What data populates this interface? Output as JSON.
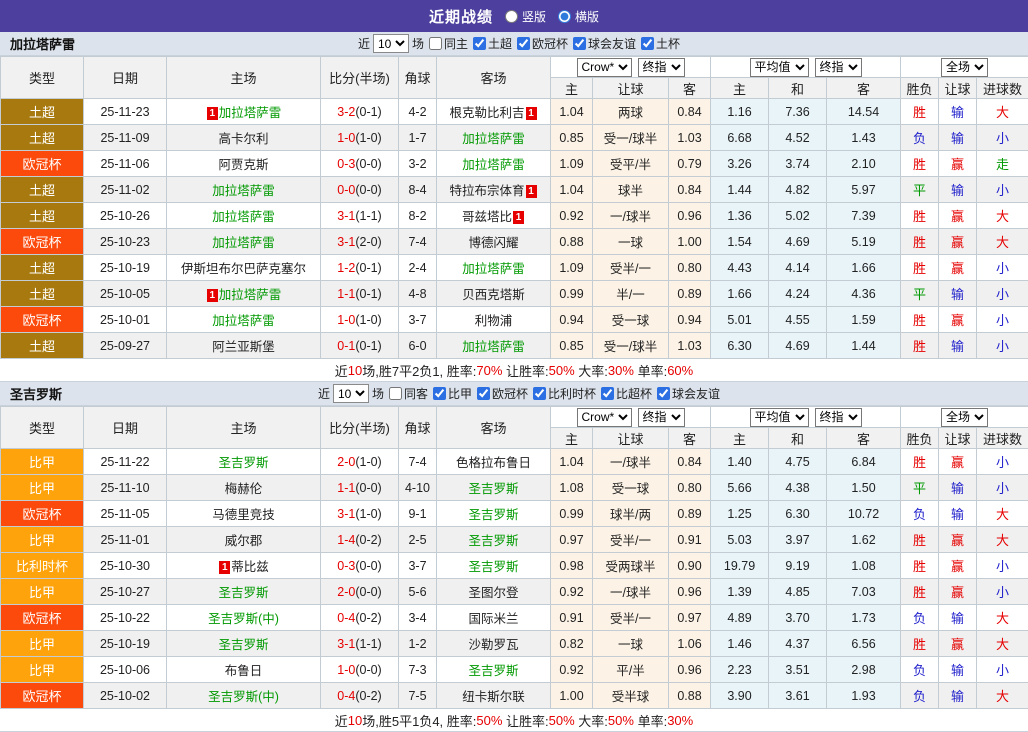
{
  "titlebar": {
    "title": "近期战绩",
    "options": [
      {
        "label": "竖版"
      },
      {
        "label": "横版",
        "checked": "checked"
      }
    ]
  },
  "colors": {
    "topbar_bg": "#4c3f9d",
    "team_highlight": "#009900",
    "score_red": "#e60000",
    "badge_bg": "#e60000"
  },
  "type_colors": {
    "土超": "#a8790f",
    "欧冠杯": "#fb4a0c",
    "比甲": "#ffa30d",
    "比利时杯": "#ffa30d"
  },
  "result_colors": {
    "胜": "#e60000",
    "赢": "#e60000",
    "大": "#e60000",
    "负": "#2222cc",
    "输": "#2222cc",
    "小": "#2222cc",
    "平": "#009900",
    "走": "#009900"
  },
  "table_header": {
    "main_cols": [
      "类型",
      "日期",
      "主场",
      "比分(半场)",
      "角球",
      "客场"
    ],
    "odds_selects": [
      "Crow*",
      "终指"
    ],
    "avg_selects": [
      "平均值",
      "终指"
    ],
    "result_selects": [
      "全场"
    ],
    "sub_cols": [
      "主",
      "让球",
      "客",
      "主",
      "和",
      "客",
      "胜负",
      "让球",
      "进球数"
    ]
  },
  "sections": [
    {
      "team": "加拉塔萨雷",
      "filter": {
        "near_label": "近",
        "count": "10",
        "games_label": "场",
        "same_label": "同主",
        "same_checked": false,
        "leagues": [
          "土超",
          "欧冠杯",
          "球会友谊",
          "土杯"
        ]
      },
      "rows": [
        {
          "type": "土超",
          "date": "25-11-23",
          "home": {
            "name": "加拉塔萨雷",
            "green": true,
            "badge": "before"
          },
          "score": "3-2",
          "half": "(0-1)",
          "corner": "4-2",
          "away": {
            "name": "根克勒比利吉",
            "badge": "after"
          },
          "odds": [
            "1.04",
            "两球",
            "0.84"
          ],
          "avg": [
            "1.16",
            "7.36",
            "14.54"
          ],
          "res": [
            "胜",
            "输",
            "大"
          ]
        },
        {
          "type": "土超",
          "date": "25-11-09",
          "home": {
            "name": "高卡尔利"
          },
          "score": "1-0",
          "half": "(1-0)",
          "corner": "1-7",
          "away": {
            "name": "加拉塔萨雷",
            "green": true
          },
          "odds": [
            "0.85",
            "受一/球半",
            "1.03"
          ],
          "avg": [
            "6.68",
            "4.52",
            "1.43"
          ],
          "res": [
            "负",
            "输",
            "小"
          ]
        },
        {
          "type": "欧冠杯",
          "date": "25-11-06",
          "home": {
            "name": "阿贾克斯"
          },
          "score": "0-3",
          "half": "(0-0)",
          "corner": "3-2",
          "away": {
            "name": "加拉塔萨雷",
            "green": true
          },
          "odds": [
            "1.09",
            "受平/半",
            "0.79"
          ],
          "avg": [
            "3.26",
            "3.74",
            "2.10"
          ],
          "res": [
            "胜",
            "赢",
            "走"
          ]
        },
        {
          "type": "土超",
          "date": "25-11-02",
          "home": {
            "name": "加拉塔萨雷",
            "green": true
          },
          "score": "0-0",
          "half": "(0-0)",
          "corner": "8-4",
          "away": {
            "name": "特拉布宗体育",
            "badge": "after"
          },
          "odds": [
            "1.04",
            "球半",
            "0.84"
          ],
          "avg": [
            "1.44",
            "4.82",
            "5.97"
          ],
          "res": [
            "平",
            "输",
            "小"
          ]
        },
        {
          "type": "土超",
          "date": "25-10-26",
          "home": {
            "name": "加拉塔萨雷",
            "green": true
          },
          "score": "3-1",
          "half": "(1-1)",
          "corner": "8-2",
          "away": {
            "name": "哥兹塔比",
            "badge": "after"
          },
          "odds": [
            "0.92",
            "一/球半",
            "0.96"
          ],
          "avg": [
            "1.36",
            "5.02",
            "7.39"
          ],
          "res": [
            "胜",
            "赢",
            "大"
          ]
        },
        {
          "type": "欧冠杯",
          "date": "25-10-23",
          "home": {
            "name": "加拉塔萨雷",
            "green": true
          },
          "score": "3-1",
          "half": "(2-0)",
          "corner": "7-4",
          "away": {
            "name": "博德闪耀"
          },
          "odds": [
            "0.88",
            "一球",
            "1.00"
          ],
          "avg": [
            "1.54",
            "4.69",
            "5.19"
          ],
          "res": [
            "胜",
            "赢",
            "大"
          ]
        },
        {
          "type": "土超",
          "date": "25-10-19",
          "home": {
            "name": "伊斯坦布尔巴萨克塞尔"
          },
          "score": "1-2",
          "half": "(0-1)",
          "corner": "2-4",
          "away": {
            "name": "加拉塔萨雷",
            "green": true
          },
          "odds": [
            "1.09",
            "受半/一",
            "0.80"
          ],
          "avg": [
            "4.43",
            "4.14",
            "1.66"
          ],
          "res": [
            "胜",
            "赢",
            "小"
          ]
        },
        {
          "type": "土超",
          "date": "25-10-05",
          "home": {
            "name": "加拉塔萨雷",
            "green": true,
            "badge": "before"
          },
          "score": "1-1",
          "half": "(0-1)",
          "corner": "4-8",
          "away": {
            "name": "贝西克塔斯"
          },
          "odds": [
            "0.99",
            "半/一",
            "0.89"
          ],
          "avg": [
            "1.66",
            "4.24",
            "4.36"
          ],
          "res": [
            "平",
            "输",
            "小"
          ]
        },
        {
          "type": "欧冠杯",
          "date": "25-10-01",
          "home": {
            "name": "加拉塔萨雷",
            "green": true
          },
          "score": "1-0",
          "half": "(1-0)",
          "corner": "3-7",
          "away": {
            "name": "利物浦"
          },
          "odds": [
            "0.94",
            "受一球",
            "0.94"
          ],
          "avg": [
            "5.01",
            "4.55",
            "1.59"
          ],
          "res": [
            "胜",
            "赢",
            "小"
          ]
        },
        {
          "type": "土超",
          "date": "25-09-27",
          "home": {
            "name": "阿兰亚斯堡"
          },
          "score": "0-1",
          "half": "(0-1)",
          "corner": "6-0",
          "away": {
            "name": "加拉塔萨雷",
            "green": true
          },
          "odds": [
            "0.85",
            "受一/球半",
            "1.03"
          ],
          "avg": [
            "6.30",
            "4.69",
            "1.44"
          ],
          "res": [
            "胜",
            "输",
            "小"
          ]
        }
      ],
      "summary": [
        {
          "text": "近"
        },
        {
          "text": "10",
          "red": true
        },
        {
          "text": "场,胜7平2负1, 胜率:"
        },
        {
          "text": "70%",
          "red": true
        },
        {
          "text": " 让胜率:"
        },
        {
          "text": "50%",
          "red": true
        },
        {
          "text": " 大率:"
        },
        {
          "text": "30%",
          "red": true
        },
        {
          "text": " 单率:"
        },
        {
          "text": "60%",
          "red": true
        }
      ]
    },
    {
      "team": "圣吉罗斯",
      "filter": {
        "near_label": "近",
        "count": "10",
        "games_label": "场",
        "same_label": "同客",
        "same_checked": false,
        "leagues": [
          "比甲",
          "欧冠杯",
          "比利时杯",
          "比超杯",
          "球会友谊"
        ]
      },
      "rows": [
        {
          "type": "比甲",
          "date": "25-11-22",
          "home": {
            "name": "圣吉罗斯",
            "green": true
          },
          "score": "2-0",
          "half": "(1-0)",
          "corner": "7-4",
          "away": {
            "name": "色格拉布鲁日"
          },
          "odds": [
            "1.04",
            "一/球半",
            "0.84"
          ],
          "avg": [
            "1.40",
            "4.75",
            "6.84"
          ],
          "res": [
            "胜",
            "赢",
            "小"
          ]
        },
        {
          "type": "比甲",
          "date": "25-11-10",
          "home": {
            "name": "梅赫伦"
          },
          "score": "1-1",
          "half": "(0-0)",
          "corner": "4-10",
          "away": {
            "name": "圣吉罗斯",
            "green": true
          },
          "odds": [
            "1.08",
            "受一球",
            "0.80"
          ],
          "avg": [
            "5.66",
            "4.38",
            "1.50"
          ],
          "res": [
            "平",
            "输",
            "小"
          ]
        },
        {
          "type": "欧冠杯",
          "date": "25-11-05",
          "home": {
            "name": "马德里竞技"
          },
          "score": "3-1",
          "half": "(1-0)",
          "corner": "9-1",
          "away": {
            "name": "圣吉罗斯",
            "green": true
          },
          "odds": [
            "0.99",
            "球半/两",
            "0.89"
          ],
          "avg": [
            "1.25",
            "6.30",
            "10.72"
          ],
          "res": [
            "负",
            "输",
            "大"
          ]
        },
        {
          "type": "比甲",
          "date": "25-11-01",
          "home": {
            "name": "威尔郡"
          },
          "score": "1-4",
          "half": "(0-2)",
          "corner": "2-5",
          "away": {
            "name": "圣吉罗斯",
            "green": true
          },
          "odds": [
            "0.97",
            "受半/一",
            "0.91"
          ],
          "avg": [
            "5.03",
            "3.97",
            "1.62"
          ],
          "res": [
            "胜",
            "赢",
            "大"
          ]
        },
        {
          "type": "比利时杯",
          "date": "25-10-30",
          "home": {
            "name": "蒂比兹",
            "badge": "before"
          },
          "score": "0-3",
          "half": "(0-0)",
          "corner": "3-7",
          "away": {
            "name": "圣吉罗斯",
            "green": true
          },
          "odds": [
            "0.98",
            "受两球半",
            "0.90"
          ],
          "avg": [
            "19.79",
            "9.19",
            "1.08"
          ],
          "res": [
            "胜",
            "赢",
            "小"
          ]
        },
        {
          "type": "比甲",
          "date": "25-10-27",
          "home": {
            "name": "圣吉罗斯",
            "green": true
          },
          "score": "2-0",
          "half": "(0-0)",
          "corner": "5-6",
          "away": {
            "name": "圣图尔登"
          },
          "odds": [
            "0.92",
            "一/球半",
            "0.96"
          ],
          "avg": [
            "1.39",
            "4.85",
            "7.03"
          ],
          "res": [
            "胜",
            "赢",
            "小"
          ]
        },
        {
          "type": "欧冠杯",
          "date": "25-10-22",
          "home": {
            "name": "圣吉罗斯(中)",
            "green": true
          },
          "score": "0-4",
          "half": "(0-2)",
          "corner": "3-4",
          "away": {
            "name": "国际米兰"
          },
          "odds": [
            "0.91",
            "受半/一",
            "0.97"
          ],
          "avg": [
            "4.89",
            "3.70",
            "1.73"
          ],
          "res": [
            "负",
            "输",
            "大"
          ]
        },
        {
          "type": "比甲",
          "date": "25-10-19",
          "home": {
            "name": "圣吉罗斯",
            "green": true
          },
          "score": "3-1",
          "half": "(1-1)",
          "corner": "1-2",
          "away": {
            "name": "沙勒罗瓦"
          },
          "odds": [
            "0.82",
            "一球",
            "1.06"
          ],
          "avg": [
            "1.46",
            "4.37",
            "6.56"
          ],
          "res": [
            "胜",
            "赢",
            "大"
          ]
        },
        {
          "type": "比甲",
          "date": "25-10-06",
          "home": {
            "name": "布鲁日"
          },
          "score": "1-0",
          "half": "(0-0)",
          "corner": "7-3",
          "away": {
            "name": "圣吉罗斯",
            "green": true
          },
          "odds": [
            "0.92",
            "平/半",
            "0.96"
          ],
          "avg": [
            "2.23",
            "3.51",
            "2.98"
          ],
          "res": [
            "负",
            "输",
            "小"
          ]
        },
        {
          "type": "欧冠杯",
          "date": "25-10-02",
          "home": {
            "name": "圣吉罗斯(中)",
            "green": true
          },
          "score": "0-4",
          "half": "(0-2)",
          "corner": "7-5",
          "away": {
            "name": "纽卡斯尔联"
          },
          "odds": [
            "1.00",
            "受半球",
            "0.88"
          ],
          "avg": [
            "3.90",
            "3.61",
            "1.93"
          ],
          "res": [
            "负",
            "输",
            "大"
          ]
        }
      ],
      "summary": [
        {
          "text": "近"
        },
        {
          "text": "10",
          "red": true
        },
        {
          "text": "场,胜5平1负4, 胜率:"
        },
        {
          "text": "50%",
          "red": true
        },
        {
          "text": " 让胜率:"
        },
        {
          "text": "50%",
          "red": true
        },
        {
          "text": " 大率:"
        },
        {
          "text": "50%",
          "red": true
        },
        {
          "text": " 单率:"
        },
        {
          "text": "30%",
          "red": true
        }
      ]
    }
  ]
}
